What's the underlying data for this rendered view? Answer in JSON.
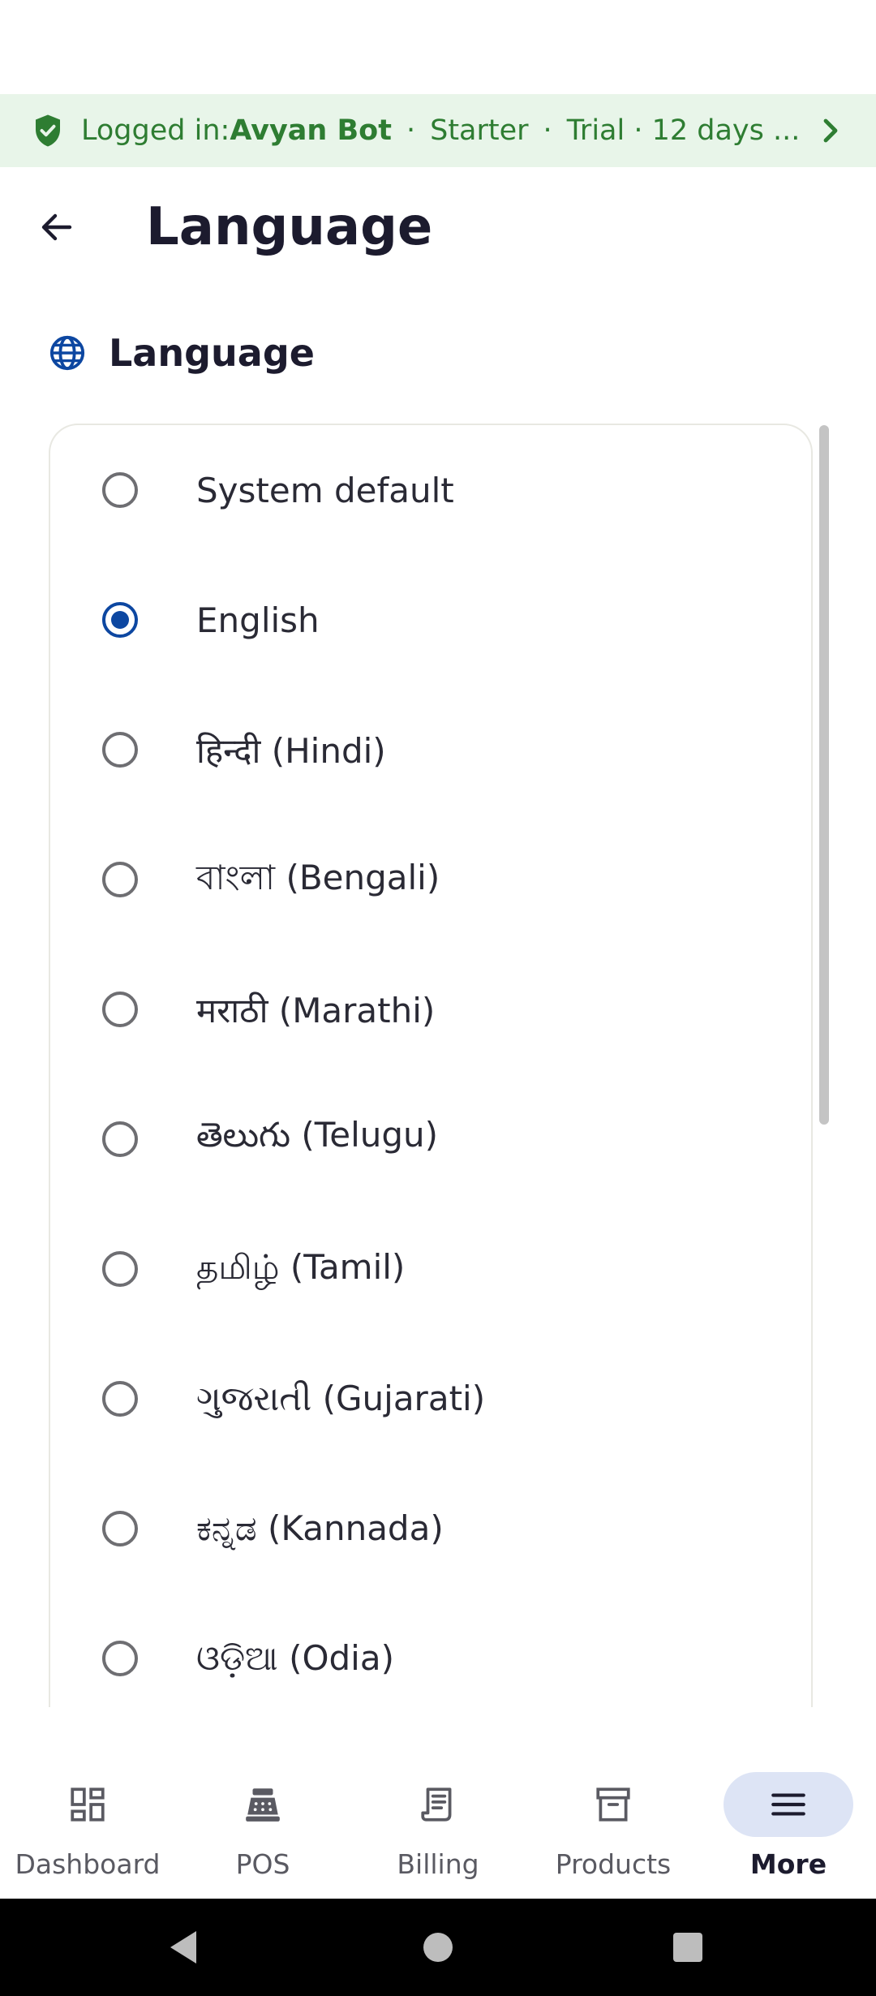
{
  "banner": {
    "prefix": "Logged in: ",
    "user": "Avyan Bot",
    "plan": "Starter",
    "trial": "Trial · 12 days ...",
    "separator": "·",
    "color": "#2e7d32"
  },
  "header": {
    "title": "Language"
  },
  "section": {
    "title": "Language",
    "icon": "globe-icon"
  },
  "options": [
    {
      "label": "System default",
      "selected": false
    },
    {
      "label": "English",
      "selected": true
    },
    {
      "label": "हिन्दी (Hindi)",
      "selected": false
    },
    {
      "label": "বাংলা (Bengali)",
      "selected": false
    },
    {
      "label": "मराठी (Marathi)",
      "selected": false
    },
    {
      "label": "తెలుగు (Telugu)",
      "selected": false
    },
    {
      "label": "தமிழ் (Tamil)",
      "selected": false
    },
    {
      "label": "ગુજરાતી (Gujarati)",
      "selected": false
    },
    {
      "label": "ಕನ್ನಡ (Kannada)",
      "selected": false
    },
    {
      "label": "ଓଡ଼ିଆ (Odia)",
      "selected": false
    }
  ],
  "bottom_nav": {
    "items": [
      {
        "label": "Dashboard",
        "icon": "dashboard-icon",
        "active": false
      },
      {
        "label": "POS",
        "icon": "pos-register-icon",
        "active": false
      },
      {
        "label": "Billing",
        "icon": "receipt-icon",
        "active": false
      },
      {
        "label": "Products",
        "icon": "archive-box-icon",
        "active": false
      },
      {
        "label": "More",
        "icon": "menu-icon",
        "active": true
      }
    ]
  },
  "colors": {
    "accent": "#0d47a1",
    "banner_bg": "#e8f5e9",
    "active_pill": "#dde4f5"
  }
}
